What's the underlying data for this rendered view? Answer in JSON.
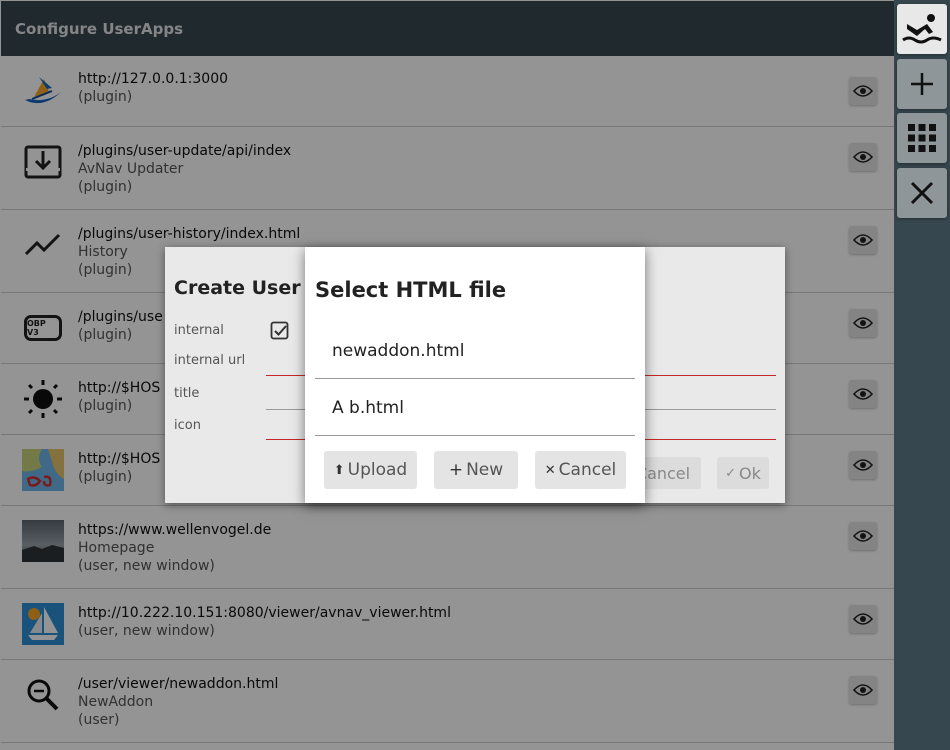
{
  "header": {
    "title": "Configure UserApps"
  },
  "apps": [
    {
      "url": "http://127.0.0.1:3000",
      "lines": [
        "(plugin)"
      ],
      "icon": "avnav-logo-icon"
    },
    {
      "url": "/plugins/user-update/api/index",
      "lines": [
        "AvNav Updater",
        "(plugin)"
      ],
      "icon": "download-icon"
    },
    {
      "url": "/plugins/user-history/index.html",
      "lines": [
        "History",
        "(plugin)"
      ],
      "icon": "trend-line-icon"
    },
    {
      "url": "/plugins/use",
      "lines": [
        "(plugin)"
      ],
      "icon": "obp-v3-icon",
      "badge": "OBP V3"
    },
    {
      "url": "http://$HOS",
      "lines": [
        "(plugin)"
      ],
      "icon": "sun-icon"
    },
    {
      "url": "http://$HOS",
      "lines": [
        "(plugin)"
      ],
      "icon": "chart-map-icon"
    },
    {
      "url": "https://www.wellenvogel.de",
      "lines": [
        "Homepage",
        "(user, new window)"
      ],
      "icon": "sky-photo-icon"
    },
    {
      "url": "http://10.222.10.151:8080/viewer/avnav_viewer.html",
      "lines": [
        "(user, new window)"
      ],
      "icon": "sailboat-icon"
    },
    {
      "url": "/user/viewer/newaddon.html",
      "lines": [
        "NewAddon",
        "(user)"
      ],
      "icon": "search-icon"
    }
  ],
  "toolbar": {
    "icons": [
      "boat-person-icon",
      "plus-icon",
      "grid-icon",
      "close-icon"
    ]
  },
  "create_dialog": {
    "title": "Create User A",
    "labels": {
      "internal": "internal",
      "internal_url": "internal url",
      "title": "title",
      "icon": "icon"
    },
    "internal_checked": true,
    "cancel_label": "Cancel",
    "ok_label": "Ok"
  },
  "select_dialog": {
    "title": "Select HTML file",
    "files": [
      "newaddon.html",
      "A b.html"
    ],
    "upload_label": "Upload",
    "new_label": "New",
    "cancel_label": "Cancel"
  },
  "colors": {
    "header_bg": "#37474f",
    "error_line": "#c62828",
    "overlay": "rgba(0,0,0,0.42)"
  }
}
